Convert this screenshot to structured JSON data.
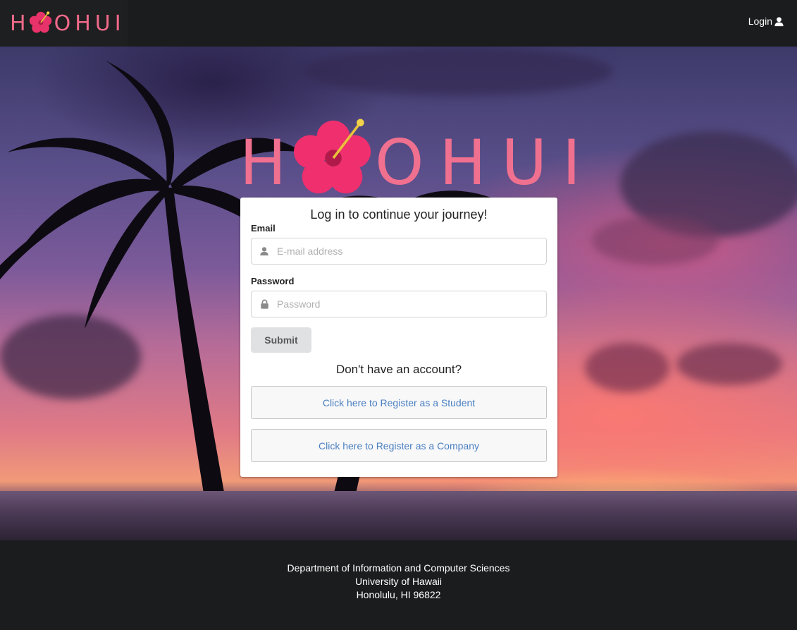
{
  "nav": {
    "brand": {
      "letters": [
        "H",
        "O",
        "H",
        "U",
        "I"
      ]
    },
    "login_label": "Login",
    "login_icon": "user-icon"
  },
  "hero": {
    "logo": {
      "letters": [
        "H",
        "O",
        "H",
        "U",
        "I"
      ]
    }
  },
  "login_card": {
    "title": "Log in to continue your journey!",
    "email": {
      "label": "Email",
      "placeholder": "E-mail address",
      "icon": "user-icon",
      "value": ""
    },
    "password": {
      "label": "Password",
      "placeholder": "Password",
      "icon": "lock-icon",
      "value": ""
    },
    "submit_label": "Submit",
    "register_prompt": "Don't have an account?",
    "register_student_label": "Click here to Register as a Student",
    "register_company_label": "Click here to Register as a Company"
  },
  "footer": {
    "line1": "Department of Information and Computer Sciences",
    "line2": "University of Hawaii",
    "line3": "Honolulu, HI 96822"
  },
  "colors": {
    "brand_pink": "#f06a8a",
    "nav_bg": "#1b1c1d",
    "link_blue": "#4a7fc0",
    "submit_bg": "#e0e1e2"
  }
}
